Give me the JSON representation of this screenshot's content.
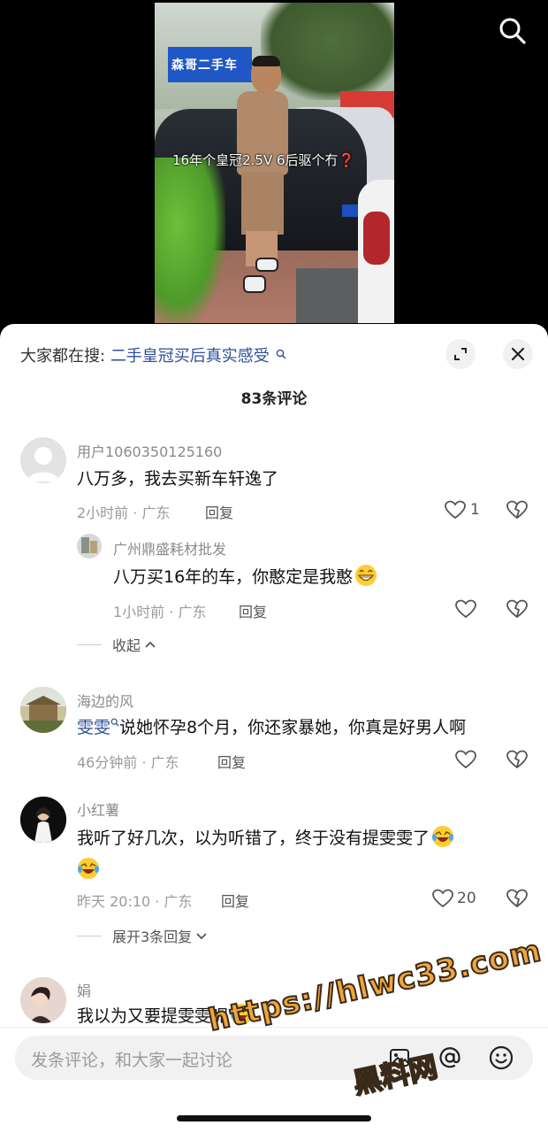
{
  "video": {
    "caption": "16年个皇冠2.5V 6后驱个冇❓",
    "shop_sign": "森哥二手车",
    "search_icon": "search-icon"
  },
  "panel": {
    "search_prefix": "大家都在搜:",
    "search_term": "二手皇冠买后真实感受",
    "comment_count": "83条评论",
    "expand_icon": "expand-icon",
    "close_icon": "close-icon"
  },
  "comments": [
    {
      "user": "用户1060350125160",
      "text": "八万多，我去买新车轩逸了",
      "time_location": "2小时前 · 广东",
      "reply_label": "回复",
      "likes": "1"
    },
    {
      "user": "广州鼎盛耗材批发",
      "text": "八万买16年的车，你憨定是我憨",
      "time_location": "1小时前 · 广东",
      "reply_label": "回复",
      "likes": ""
    },
    {
      "user": "海边的风",
      "mention": "雯雯",
      "text": "说她怀孕8个月，你还家暴她，你真是好男人啊",
      "time_location": "46分钟前 · 广东",
      "reply_label": "回复",
      "likes": ""
    },
    {
      "user": "小红薯",
      "text": "我听了好几次，以为听错了，终于没有提雯雯了",
      "time_location": "昨天 20:10 · 广东",
      "reply_label": "回复",
      "likes": "20"
    },
    {
      "user": "娟",
      "text": "我以为又要提雯雯呢",
      "time_location": "",
      "reply_label": "",
      "likes": ""
    }
  ],
  "collapse_label": "收起",
  "expand_replies_label": "展开3条回复",
  "input": {
    "placeholder": "发条评论，和大家一起讨论",
    "image_icon": "image-icon",
    "at_icon": "at-icon",
    "emoji_icon": "emoji-icon"
  },
  "watermark": {
    "url": "https://hlwc33.com",
    "name": "黑料网"
  }
}
